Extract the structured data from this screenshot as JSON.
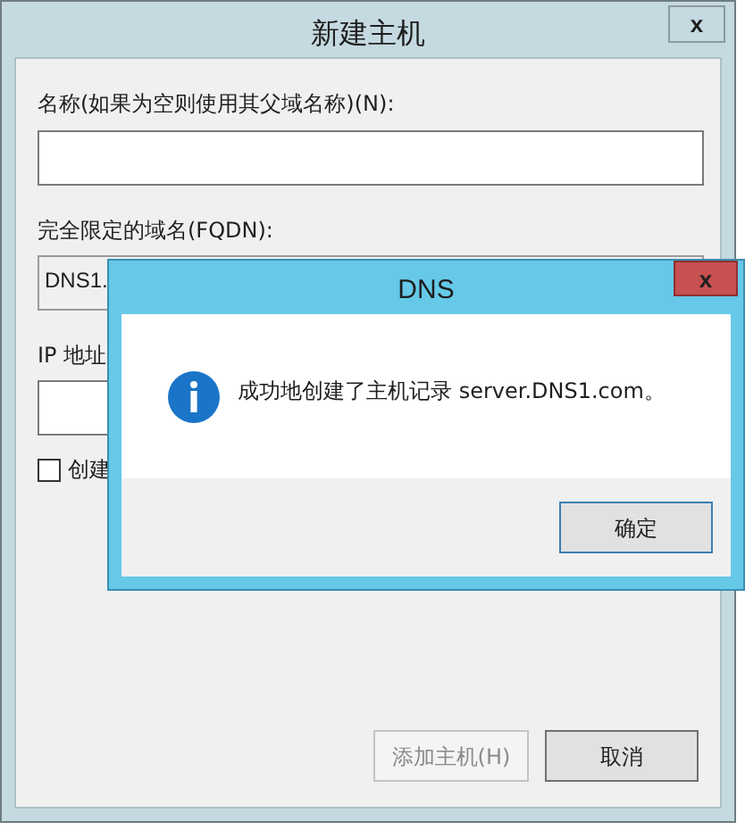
{
  "main_dialog": {
    "title": "新建主机",
    "close": "x",
    "name_label": "名称(如果为空则使用其父域名称)(N):",
    "fqdn_label": "完全限定的域名(FQDN):",
    "fqdn_value": "DNS1.",
    "ip_label": "IP 地址",
    "checkbox": {
      "label": "创建",
      "checked": false
    },
    "buttons": [
      {
        "label": "添加主机(H)",
        "disabled": true
      },
      {
        "label": "取消",
        "disabled": false
      }
    ]
  },
  "message_box": {
    "title": "DNS",
    "close": "x",
    "message": "成功地创建了主机记录 server.DNS1.com。",
    "button": "确定"
  }
}
